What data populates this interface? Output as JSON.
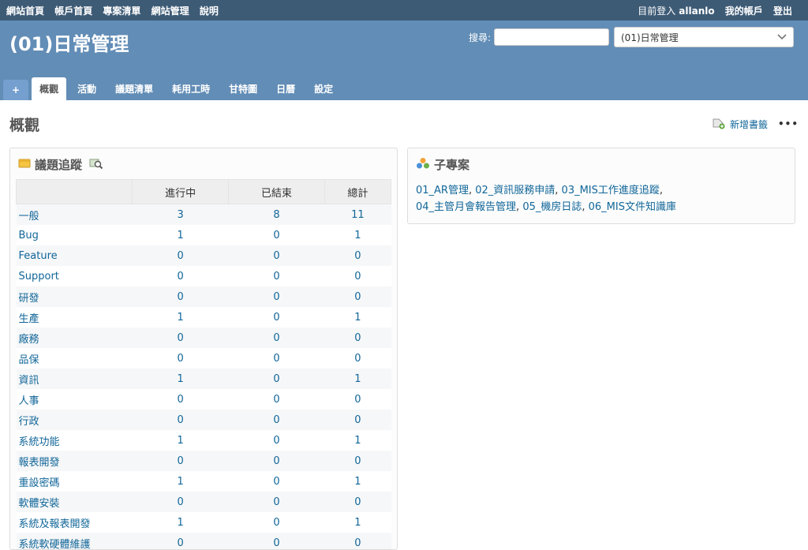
{
  "top_menu": {
    "left": [
      "網站首頁",
      "帳戶首頁",
      "專案清單",
      "網站管理",
      "說明"
    ],
    "logged_in_prefix": "目前登入",
    "user": "allanlo",
    "my_account": "我的帳戶",
    "logout": "登出"
  },
  "header": {
    "project_title": "(01)日常管理",
    "search_label": "搜尋:",
    "search_value": "",
    "project_select": "(01)日常管理"
  },
  "tabs": [
    {
      "label": "+"
    },
    {
      "label": "概觀"
    },
    {
      "label": "活動"
    },
    {
      "label": "議題清單"
    },
    {
      "label": "耗用工時"
    },
    {
      "label": "甘特圖"
    },
    {
      "label": "日曆"
    },
    {
      "label": "設定"
    }
  ],
  "page": {
    "title": "概觀",
    "bookmark": "新增書籤",
    "more": "•••"
  },
  "issues_box": {
    "title": "議題追蹤",
    "headers": [
      "",
      "進行中",
      "已結束",
      "總計"
    ],
    "rows": [
      {
        "name": "一般",
        "open": "3",
        "closed": "8",
        "total": "11"
      },
      {
        "name": "Bug",
        "open": "1",
        "closed": "0",
        "total": "1"
      },
      {
        "name": "Feature",
        "open": "0",
        "closed": "0",
        "total": "0"
      },
      {
        "name": "Support",
        "open": "0",
        "closed": "0",
        "total": "0"
      },
      {
        "name": "研發",
        "open": "0",
        "closed": "0",
        "total": "0"
      },
      {
        "name": "生產",
        "open": "1",
        "closed": "0",
        "total": "1"
      },
      {
        "name": "廠務",
        "open": "0",
        "closed": "0",
        "total": "0"
      },
      {
        "name": "品保",
        "open": "0",
        "closed": "0",
        "total": "0"
      },
      {
        "name": "資訊",
        "open": "1",
        "closed": "0",
        "total": "1"
      },
      {
        "name": "人事",
        "open": "0",
        "closed": "0",
        "total": "0"
      },
      {
        "name": "行政",
        "open": "0",
        "closed": "0",
        "total": "0"
      },
      {
        "name": "系統功能",
        "open": "1",
        "closed": "0",
        "total": "1"
      },
      {
        "name": "報表開發",
        "open": "0",
        "closed": "0",
        "total": "0"
      },
      {
        "name": "重設密碼",
        "open": "1",
        "closed": "0",
        "total": "1"
      },
      {
        "name": "軟體安裝",
        "open": "0",
        "closed": "0",
        "total": "0"
      },
      {
        "name": "系統及報表開發",
        "open": "1",
        "closed": "0",
        "total": "1"
      },
      {
        "name": "系統軟硬體維護",
        "open": "0",
        "closed": "0",
        "total": "0"
      }
    ]
  },
  "subprojects_box": {
    "title": "子專案",
    "links": [
      [
        "01_AR管理",
        "02_資訊服務申請",
        "03_MIS工作進度追蹤"
      ],
      [
        "04_主管月會報告管理",
        "05_機房日誌",
        "06_MIS文件知識庫"
      ]
    ]
  },
  "icons": {
    "issues": "issue-tracking-icon",
    "search_issues": "magnifier-icon",
    "subprojects": "subproject-icon",
    "bookmark": "bookmark-add-icon",
    "dropdown": "chevron-down-icon"
  }
}
